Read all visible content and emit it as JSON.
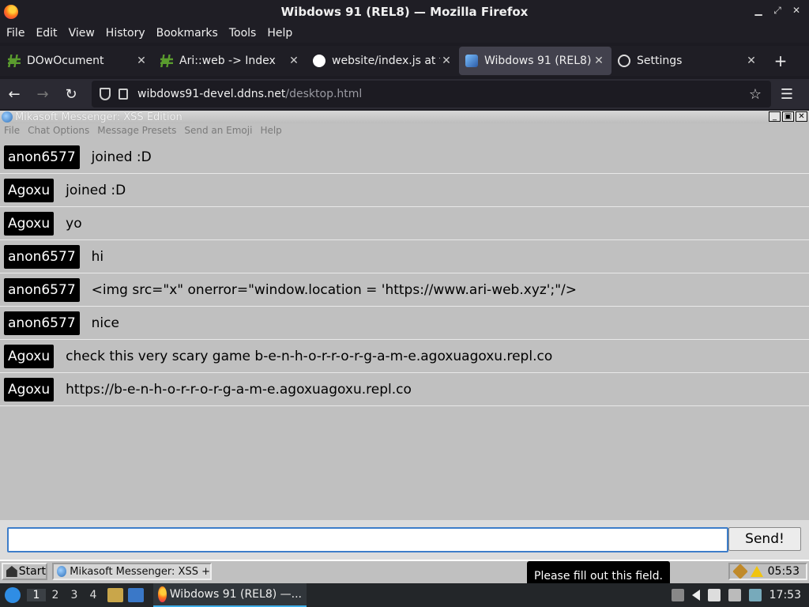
{
  "window": {
    "title": "Wibdows 91 (REL8) — Mozilla Firefox"
  },
  "menubar": [
    "File",
    "Edit",
    "View",
    "History",
    "Bookmarks",
    "Tools",
    "Help"
  ],
  "tabs": [
    {
      "label": "DOwOcument",
      "icon": "document-icon",
      "active": false
    },
    {
      "label": "Ari::web -> Index",
      "icon": "hash-icon",
      "active": false
    },
    {
      "label": "website/index.js at t",
      "icon": "github-icon",
      "active": false
    },
    {
      "label": "Wibdows 91 (REL8)",
      "icon": "wibdows-icon",
      "active": true
    },
    {
      "label": "Settings",
      "icon": "gear-icon",
      "active": false
    }
  ],
  "urlbar": {
    "host": "wibdows91-devel.ddns.net",
    "path": "/desktop.html"
  },
  "app": {
    "title": "Mikasoft Messenger: XSS Edition",
    "menu": [
      "File",
      "Chat Options",
      "Message Presets",
      "Send an Emoji",
      "Help"
    ],
    "messages": [
      {
        "user": "anon6577",
        "text": "joined :D"
      },
      {
        "user": "Agoxu",
        "text": "joined :D"
      },
      {
        "user": "Agoxu",
        "text": "yo"
      },
      {
        "user": "anon6577",
        "text": "hi"
      },
      {
        "user": "anon6577",
        "text": "<img src=\"x\" onerror=\"window.location = 'https://www.ari-web.xyz';\"/>"
      },
      {
        "user": "anon6577",
        "text": "nice"
      },
      {
        "user": "Agoxu",
        "text": "check this very scary game b-e-n-h-o-r-r-o-r-g-a-m-e.agoxuagoxu.repl.co"
      },
      {
        "user": "Agoxu",
        "text": "https://b-e-n-h-o-r-r-o-r-g-a-m-e.agoxuagoxu.repl.co"
      }
    ],
    "input_value": "",
    "send_label": "Send!"
  },
  "w91_taskbar": {
    "start_label": "Start",
    "task_label": "Mikasoft Messenger: XSS +",
    "clock": "05:53"
  },
  "tooltip": "Please fill out this field.",
  "panel": {
    "workspaces": [
      "1",
      "2",
      "3",
      "4"
    ],
    "task_label": "Wibdows 91 (REL8) —...",
    "clock": "17:53"
  },
  "colors": {
    "accent": "#3daee9",
    "input_border": "#3d7dc9"
  }
}
